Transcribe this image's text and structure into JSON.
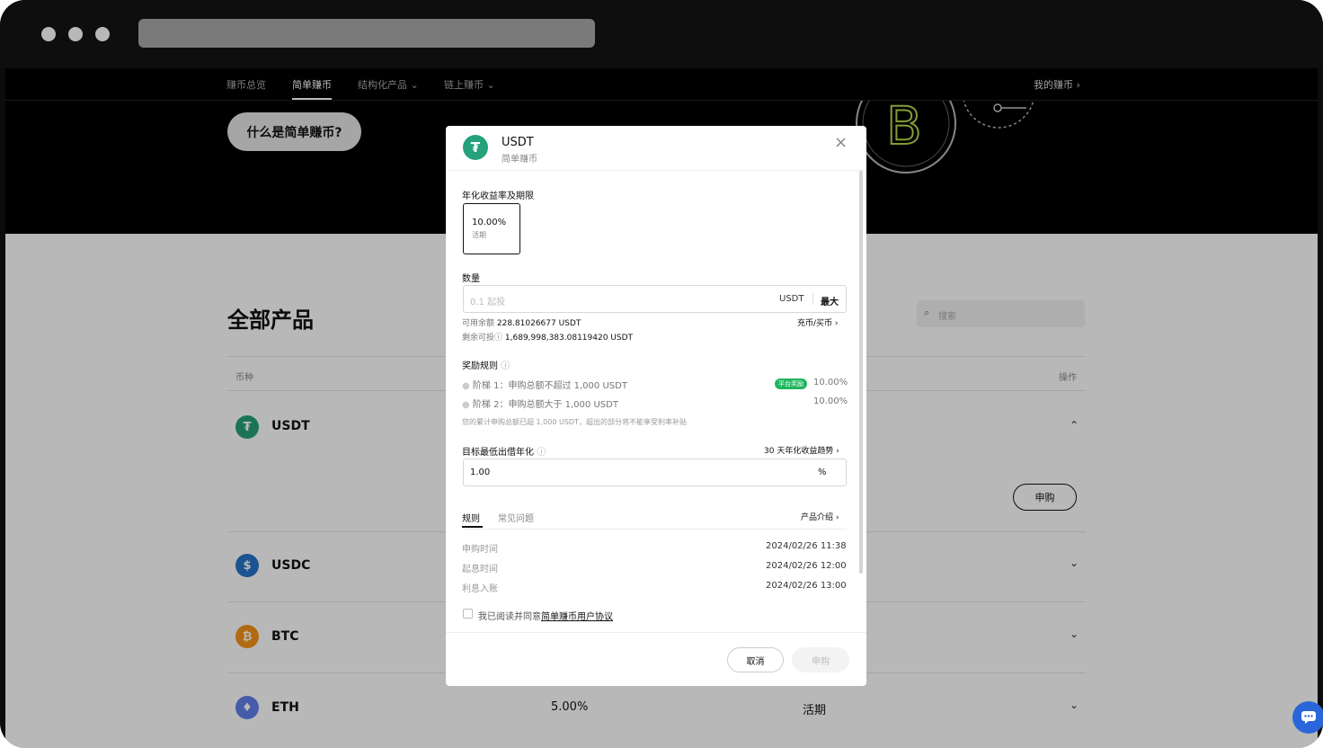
{
  "nav": {
    "items": [
      "赚币总览",
      "简单赚币",
      "结构化产品",
      "链上赚币"
    ],
    "right": "我的赚币"
  },
  "hero": {
    "button": "什么是简单赚币?"
  },
  "content": {
    "title": "全部产品",
    "search_placeholder": "搜索",
    "col_coin": "币种",
    "col_action": "操作",
    "coins": [
      {
        "name": "USDT",
        "icon": "usdt-icon",
        "color": "#26a17b",
        "glyph": "₮"
      },
      {
        "name": "USDC",
        "icon": "usdc-icon",
        "color": "#2775ca",
        "glyph": "$"
      },
      {
        "name": "BTC",
        "icon": "btc-icon",
        "color": "#f7931a",
        "glyph": "₿"
      },
      {
        "name": "ETH",
        "icon": "eth-icon",
        "color": "#627eea",
        "glyph": "♦",
        "rate": "5.00%",
        "term": "活期"
      }
    ],
    "subscribe": "申购"
  },
  "modal": {
    "coin": "USDT",
    "subtitle": "简单赚币",
    "apy_label": "年化收益率及期限",
    "apy_value": "10.00%",
    "apy_term": "活期",
    "qty_label": "数量",
    "qty_placeholder": "0.1 起投",
    "qty_unit": "USDT",
    "qty_max": "最大",
    "avail_label": "可用余额",
    "avail_value": "228.81026677 USDT",
    "deposit_link": "充币/买币",
    "remain_label": "剩余可投",
    "remain_value": "1,689,998,383.08119420 USDT",
    "reward_label": "奖励规则",
    "tier1": "阶梯 1：申购总额不超过 1,000 USDT",
    "tier1_badge": "平台奖励",
    "tier1_rate": "10.00%",
    "tier2": "阶梯 2：申购总额大于 1,000 USDT",
    "tier2_rate": "10.00%",
    "tier_note": "您的累计申购总额已超 1,000 USDT，超出的部分将不能享受利率补贴",
    "min_label": "目标最低出借年化",
    "trend_link": "30 天年化收益趋势",
    "min_value": "1.00",
    "min_unit": "%",
    "tab_rules": "规则",
    "tab_faq": "常见问题",
    "intro_link": "产品介绍",
    "times": [
      {
        "label": "申购时间",
        "value": "2024/02/26 11:38"
      },
      {
        "label": "起息时间",
        "value": "2024/02/26 12:00"
      },
      {
        "label": "利息入账",
        "value": "2024/02/26 13:00"
      }
    ],
    "agree_text": "我已阅读并同意",
    "agree_link": "简单赚币用户协议",
    "cancel": "取消",
    "submit": "申购"
  }
}
